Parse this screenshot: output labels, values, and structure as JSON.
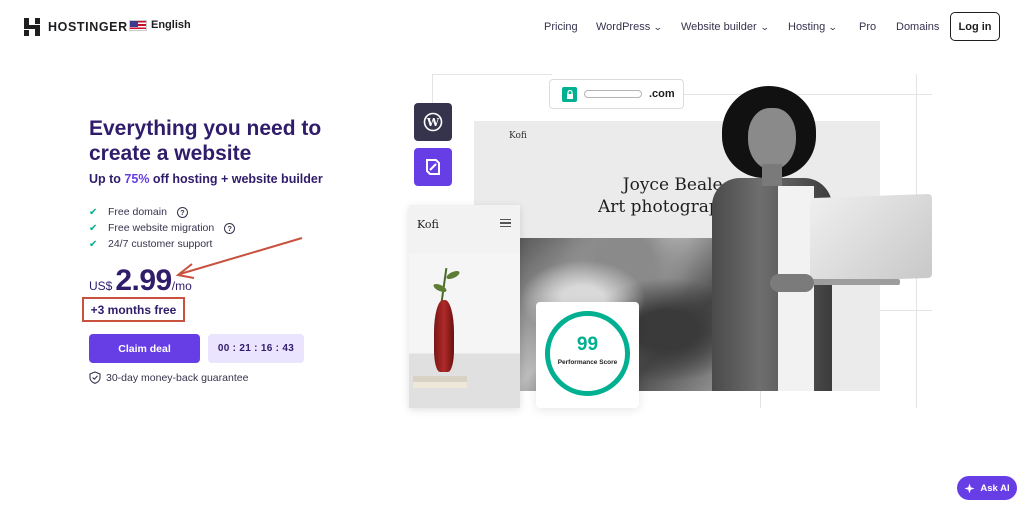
{
  "header": {
    "logo_text": "HOSTINGER",
    "language": "English",
    "nav": [
      {
        "label": "Pricing",
        "has_dropdown": false
      },
      {
        "label": "WordPress",
        "has_dropdown": true
      },
      {
        "label": "Website builder",
        "has_dropdown": true
      },
      {
        "label": "Hosting",
        "has_dropdown": true
      },
      {
        "label": "Pro",
        "has_dropdown": false
      },
      {
        "label": "Domains",
        "has_dropdown": false
      }
    ],
    "login_label": "Log in"
  },
  "hero": {
    "title": "Everything you need to create a website",
    "subtitle_prefix": "Up to ",
    "subtitle_accent": "75%",
    "subtitle_suffix": " off hosting + website builder",
    "features": [
      {
        "label": "Free domain",
        "has_help": true
      },
      {
        "label": "Free website migration",
        "has_help": true
      },
      {
        "label": "24/7 customer support",
        "has_help": false
      }
    ],
    "currency": "US$",
    "price": "2.99",
    "period": "/mo",
    "promo": "+3 months free",
    "cta_label": "Claim deal",
    "timer": "00 : 21 : 16 : 43",
    "guarantee": "30-day money-back guarantee"
  },
  "preview": {
    "url_suffix": ".com",
    "site_brand": "Kofi",
    "site_headline_line1": "Joyce Beale,",
    "site_headline_line2": "Art photograph",
    "mobile_brand": "Kofi",
    "performance_score": "99",
    "performance_label": "Performance Score"
  },
  "ask_ai_label": "Ask AI",
  "colors": {
    "brand": "#673de6",
    "heading": "#2f1c6a",
    "success": "#00b090",
    "annotation": "#c9513e"
  }
}
